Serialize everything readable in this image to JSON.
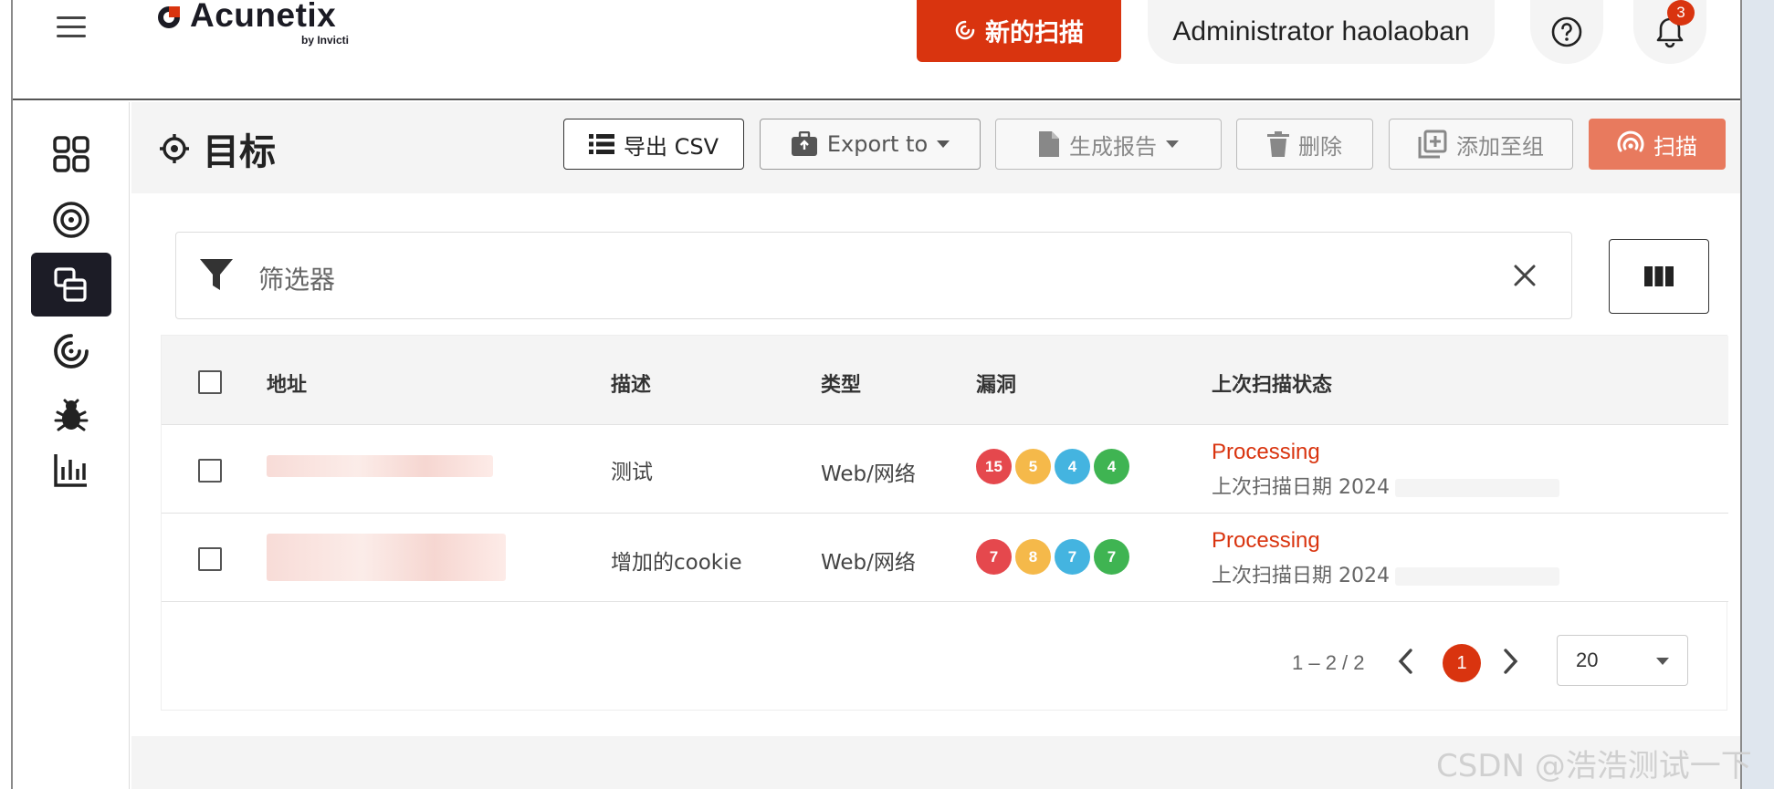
{
  "header": {
    "brand": "Acunetix",
    "brand_sub": "by Invicti",
    "new_scan_label": "新的扫描",
    "user_name": "Administrator haolaoban",
    "notification_count": "3"
  },
  "page": {
    "title": "目标"
  },
  "toolbar": {
    "export_csv": "导出 CSV",
    "export_to": "Export to",
    "generate_report": "生成报告",
    "delete": "删除",
    "add_to_group": "添加至组",
    "scan": "扫描"
  },
  "filter": {
    "placeholder": "筛选器"
  },
  "table": {
    "headers": [
      "地址",
      "描述",
      "类型",
      "漏洞",
      "上次扫描状态"
    ],
    "rows": [
      {
        "description": "测试",
        "type": "Web/网络",
        "vulns": [
          "15",
          "5",
          "4",
          "4"
        ],
        "status": "Processing",
        "last_scan": "上次扫描日期 2024"
      },
      {
        "description": "增加的cookie",
        "type": "Web/网络",
        "vulns": [
          "7",
          "8",
          "7",
          "7"
        ],
        "status": "Processing",
        "last_scan": "上次扫描日期 2024"
      }
    ]
  },
  "pagination": {
    "range": "1 – 2 / 2",
    "current_page": "1",
    "page_size": "20"
  },
  "colors": {
    "accent": "#d9340f",
    "critical": "#e5484d",
    "high": "#f5b94a",
    "medium": "#44b4e0",
    "low": "#3fb452"
  },
  "watermark": "CSDN @浩浩测试一下"
}
